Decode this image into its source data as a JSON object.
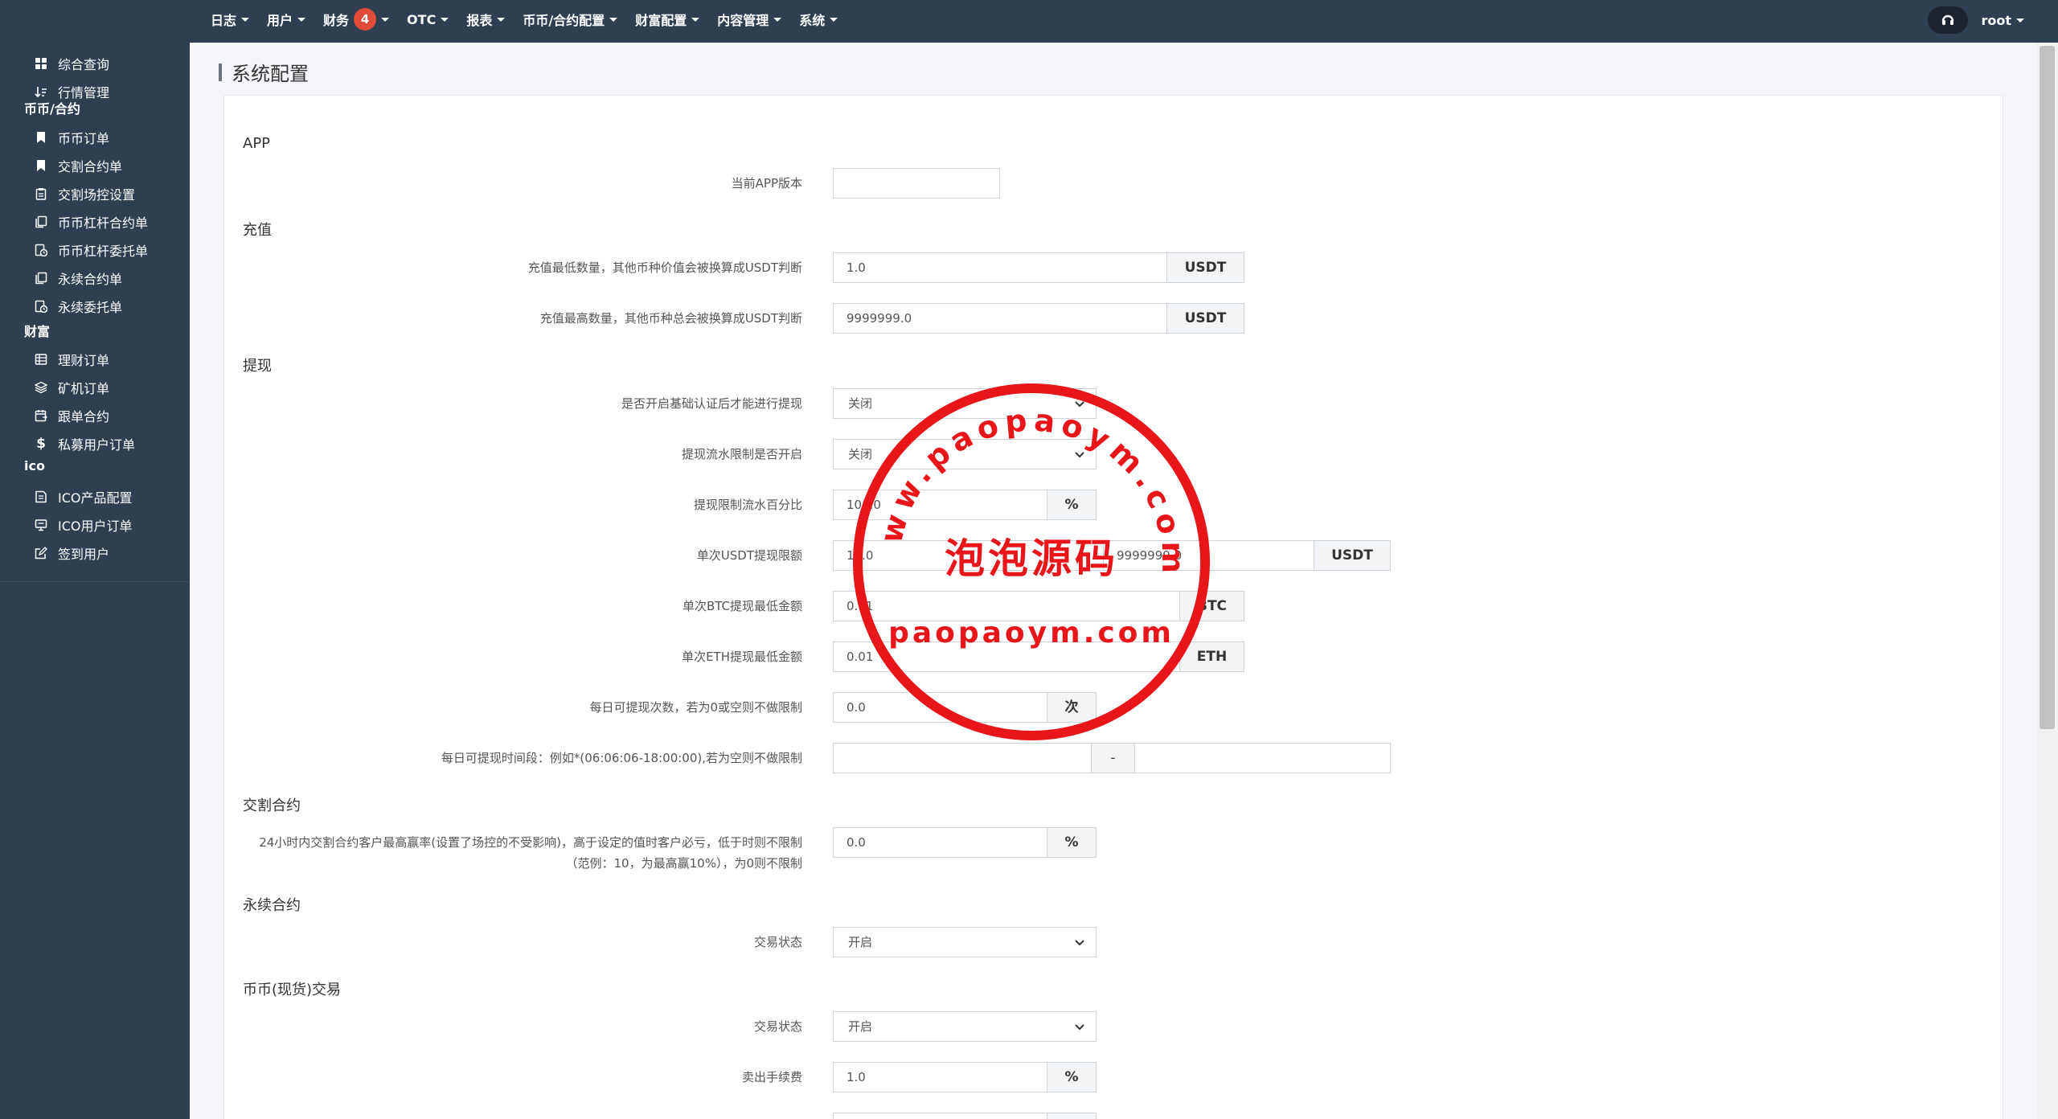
{
  "nav": {
    "items": [
      {
        "label": "日志"
      },
      {
        "label": "用户"
      },
      {
        "label": "财务",
        "badge": "4"
      },
      {
        "label": "OTC"
      },
      {
        "label": "报表"
      },
      {
        "label": "币币/合约配置"
      },
      {
        "label": "财富配置"
      },
      {
        "label": "内容管理"
      },
      {
        "label": "系统"
      }
    ],
    "username": "root"
  },
  "sidebar": {
    "items_top": [
      {
        "label": "综合查询",
        "icon": "dashboard-icon"
      },
      {
        "label": "行情管理",
        "icon": "sort-icon"
      }
    ],
    "group1": "币币/合约",
    "items_g1": [
      {
        "label": "币币订单",
        "icon": "bookmark-icon"
      },
      {
        "label": "交割合约单",
        "icon": "bookmark-icon"
      },
      {
        "label": "交割场控设置",
        "icon": "clipboard-icon"
      },
      {
        "label": "币币杠杆合约单",
        "icon": "copy-icon"
      },
      {
        "label": "币币杠杆委托单",
        "icon": "file-clock-icon"
      },
      {
        "label": "永续合约单",
        "icon": "copy-icon"
      },
      {
        "label": "永续委托单",
        "icon": "file-clock-icon"
      }
    ],
    "group2": "财富",
    "items_g2": [
      {
        "label": "理财订单",
        "icon": "database-icon"
      },
      {
        "label": "矿机订单",
        "icon": "layers-icon"
      },
      {
        "label": "跟单合约",
        "icon": "calendar-icon"
      },
      {
        "label": "私募用户订单",
        "icon": "dollar-icon"
      }
    ],
    "group3": "ico",
    "items_g3": [
      {
        "label": "ICO产品配置",
        "icon": "note-icon"
      },
      {
        "label": "ICO用户订单",
        "icon": "monitor-icon"
      },
      {
        "label": "签到用户",
        "icon": "edit-icon"
      }
    ]
  },
  "page": {
    "title": "系统配置"
  },
  "sections": {
    "app": "APP",
    "recharge": "充值",
    "withdraw": "提现",
    "delivery": "交割合约",
    "perpetual": "永续合约",
    "spot": "币币(现货)交易"
  },
  "fields": {
    "app_version": {
      "label": "当前APP版本",
      "value": ""
    },
    "recharge_min": {
      "label": "充值最低数量，其他币种价值会被换算成USDT判断",
      "value": "1.0",
      "unit": "USDT"
    },
    "recharge_max": {
      "label": "充值最高数量，其他币种总会被换算成USDT判断",
      "value": "9999999.0",
      "unit": "USDT"
    },
    "withdraw_kyc": {
      "label": "是否开启基础认证后才能进行提现",
      "value": "关闭"
    },
    "withdraw_flow": {
      "label": "提现流水限制是否开启",
      "value": "关闭"
    },
    "withdraw_flow_pct": {
      "label": "提现限制流水百分比",
      "value": "100.0",
      "unit": "%"
    },
    "withdraw_usdt": {
      "label": "单次USDT提现限额",
      "value_min": "10.0",
      "value_max": "9999999.0",
      "unit": "USDT"
    },
    "withdraw_btc": {
      "label": "单次BTC提现最低金额",
      "value": "0.01",
      "unit": "BTC"
    },
    "withdraw_eth": {
      "label": "单次ETH提现最低金额",
      "value": "0.01",
      "unit": "ETH"
    },
    "withdraw_daily": {
      "label": "每日可提现次数，若为0或空则不做限制",
      "value": "0.0",
      "unit": "次"
    },
    "withdraw_time": {
      "label": "每日可提现时间段：例如*(06:06:06-18:00:00),若为空则不做限制",
      "value_from": "",
      "sep": "-",
      "value_to": ""
    },
    "delivery_winrate": {
      "label": "24小时内交割合约客户最高赢率(设置了场控的不受影响)，高于设定的值时客户必亏，低于时则不限制（范例：10，为最高赢10%），为0则不限制",
      "value": "0.0",
      "unit": "%"
    },
    "perp_status": {
      "label": "交易状态",
      "value": "开启"
    },
    "spot_status": {
      "label": "交易状态",
      "value": "开启"
    },
    "spot_sell_fee": {
      "label": "卖出手续费",
      "value": "1.0",
      "unit": "%"
    }
  },
  "watermark": {
    "arc_text": "www.paopaoym.com",
    "cn_text": "泡泡源码",
    "en_text": "paopaoym.com",
    "color": "#e8161b"
  }
}
